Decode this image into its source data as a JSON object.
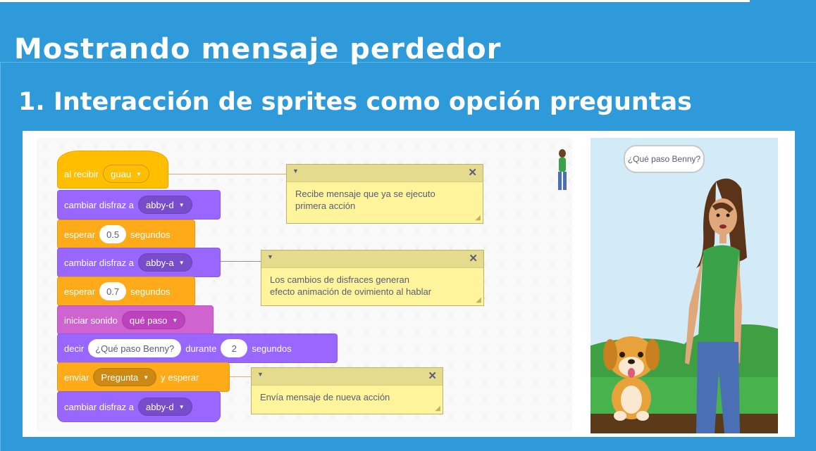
{
  "slide": {
    "title": "Mostrando mensaje perdedor",
    "subtitle": "1.  Interacción de sprites como opción preguntas"
  },
  "colors": {
    "background": "#2f9ad9",
    "events": "#ffbf00",
    "control": "#ffab19",
    "looks": "#9966ff",
    "sound": "#cf63cf",
    "comment": "#fef49c"
  },
  "blocks": {
    "when_receive": {
      "label": "al recibir",
      "message": "guau"
    },
    "switch_costume_1": {
      "label": "cambiar disfraz a",
      "costume": "abby-d"
    },
    "wait_1": {
      "label": "esperar",
      "value": "0.5",
      "unit": "segundos"
    },
    "switch_costume_2": {
      "label": "cambiar disfraz a",
      "costume": "abby-a"
    },
    "wait_2": {
      "label": "esperar",
      "value": "0.7",
      "unit": "segundos"
    },
    "start_sound": {
      "label": "iniciar sonido",
      "sound": "qué paso"
    },
    "say_for": {
      "label": "decir",
      "text": "¿Qué paso Benny?",
      "middle": "durante",
      "seconds": "2",
      "unit": "segundos"
    },
    "broadcast_wait": {
      "label": "enviar",
      "message": "Pregunta",
      "suffix": "y esperar"
    },
    "switch_costume_3": {
      "label": "cambiar disfraz a",
      "costume": "abby-d"
    }
  },
  "comments": [
    {
      "text_lines": [
        "Recibe mensaje  que ya se  ejecuto",
        "primera  acción"
      ]
    },
    {
      "text_lines": [
        "Los   cambios  de disfraces generan",
        "efecto animación de ovimiento al   hablar"
      ]
    },
    {
      "text_lines": [
        "Envía mensaje de nueva   acción"
      ]
    }
  ],
  "stage": {
    "speech_bubble": "¿Qué paso Benny?"
  },
  "icons": {
    "dropdown": "chevron-down-icon",
    "comment_collapse": "chevron-down-icon",
    "comment_close": "close-icon",
    "comment_resize": "resize-grip-icon"
  }
}
